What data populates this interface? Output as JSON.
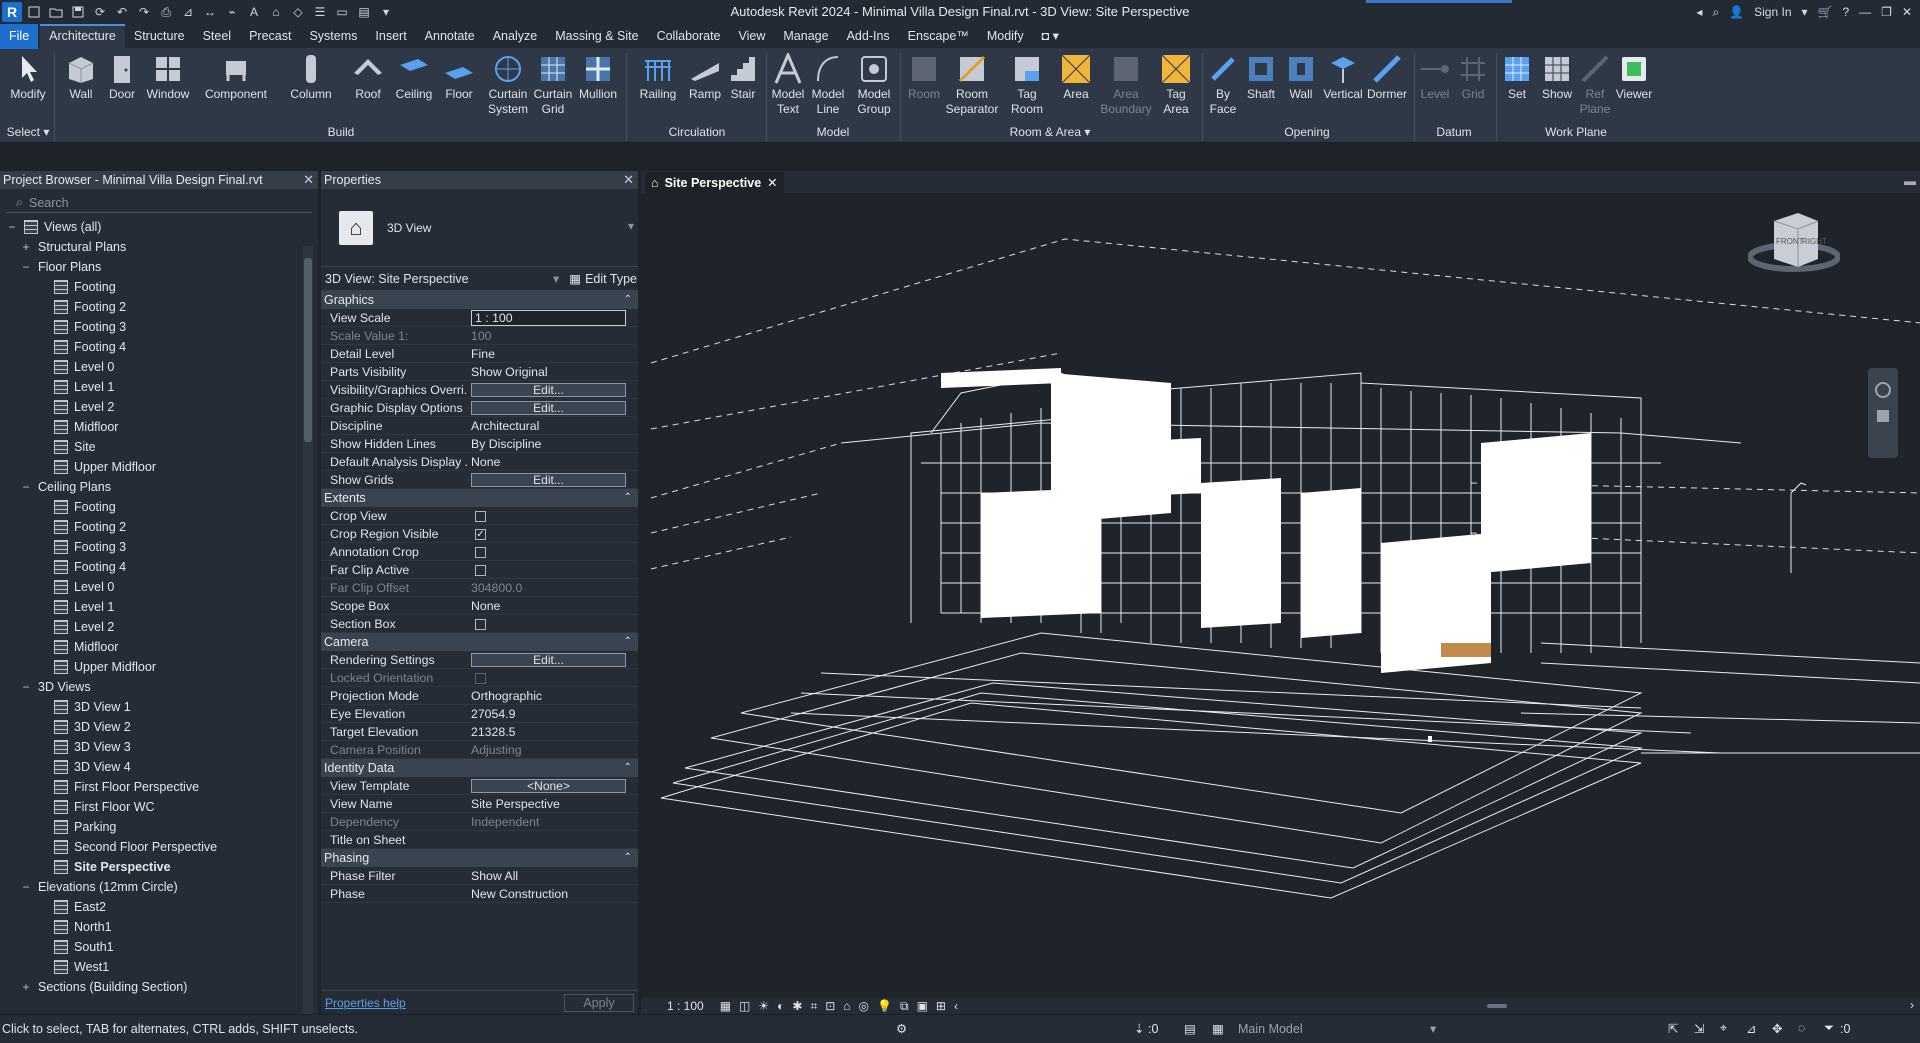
{
  "app": {
    "title": "Autodesk Revit 2024 - Minimal Villa Design Final.rvt - 3D View: Site Perspective",
    "sign_in": "Sign In"
  },
  "menu": [
    "File",
    "Architecture",
    "Structure",
    "Steel",
    "Precast",
    "Systems",
    "Insert",
    "Annotate",
    "Analyze",
    "Massing & Site",
    "Collaborate",
    "View",
    "Manage",
    "Add-Ins",
    "Enscape™",
    "Modify"
  ],
  "ribbon": {
    "select": "Select",
    "buttons": {
      "modify": "Modify",
      "wall": "Wall",
      "door": "Door",
      "window": "Window",
      "component": "Component",
      "column": "Column",
      "roof": "Roof",
      "ceiling": "Ceiling",
      "floor": "Floor",
      "curtain_system": "Curtain\nSystem",
      "curtain_grid": "Curtain\nGrid",
      "mullion": "Mullion",
      "railing": "Railing",
      "ramp": "Ramp",
      "stair": "Stair",
      "model_text": "Model\nText",
      "model_line": "Model\nLine",
      "model_group": "Model\nGroup",
      "room": "Room",
      "room_separator": "Room\nSeparator",
      "tag_room": "Tag\nRoom",
      "area": "Area",
      "area_boundary": "Area\nBoundary",
      "tag_area": "Tag\nArea",
      "by_face": "By\nFace",
      "shaft": "Shaft",
      "wall_op": "Wall",
      "vertical": "Vertical",
      "dormer": "Dormer",
      "level": "Level",
      "grid": "Grid",
      "set": "Set",
      "show": "Show",
      "ref_plane": "Ref\nPlane",
      "viewer": "Viewer"
    },
    "panels": {
      "build": "Build",
      "circulation": "Circulation",
      "model": "Model",
      "room_area": "Room & Area",
      "opening": "Opening",
      "datum": "Datum",
      "work_plane": "Work Plane"
    }
  },
  "project_browser": {
    "title": "Project Browser - Minimal Villa Design Final.rvt",
    "search_placeholder": "Search",
    "tree": [
      {
        "label": "Views (all)",
        "level": 0,
        "toggle": "−",
        "icon": "views"
      },
      {
        "label": "Structural Plans",
        "level": 1,
        "toggle": "+"
      },
      {
        "label": "Floor Plans",
        "level": 1,
        "toggle": "−"
      },
      {
        "label": "Footing",
        "level": 2
      },
      {
        "label": "Footing 2",
        "level": 2
      },
      {
        "label": "Footing 3",
        "level": 2
      },
      {
        "label": "Footing 4",
        "level": 2
      },
      {
        "label": "Level 0",
        "level": 2
      },
      {
        "label": "Level 1",
        "level": 2
      },
      {
        "label": "Level 2",
        "level": 2
      },
      {
        "label": "Midfloor",
        "level": 2
      },
      {
        "label": "Site",
        "level": 2
      },
      {
        "label": "Upper Midfloor",
        "level": 2
      },
      {
        "label": "Ceiling Plans",
        "level": 1,
        "toggle": "−"
      },
      {
        "label": "Footing",
        "level": 2
      },
      {
        "label": "Footing 2",
        "level": 2
      },
      {
        "label": "Footing 3",
        "level": 2
      },
      {
        "label": "Footing 4",
        "level": 2
      },
      {
        "label": "Level 0",
        "level": 2
      },
      {
        "label": "Level 1",
        "level": 2
      },
      {
        "label": "Level 2",
        "level": 2
      },
      {
        "label": "Midfloor",
        "level": 2
      },
      {
        "label": "Upper Midfloor",
        "level": 2
      },
      {
        "label": "3D Views",
        "level": 1,
        "toggle": "−"
      },
      {
        "label": "3D View 1",
        "level": 2
      },
      {
        "label": "3D View 2",
        "level": 2
      },
      {
        "label": "3D View 3",
        "level": 2
      },
      {
        "label": "3D View 4",
        "level": 2
      },
      {
        "label": "First Floor Perspective",
        "level": 2
      },
      {
        "label": "First Floor WC",
        "level": 2
      },
      {
        "label": "Parking",
        "level": 2
      },
      {
        "label": "Second Floor Perspective",
        "level": 2
      },
      {
        "label": "Site Perspective",
        "level": 2,
        "bold": true
      },
      {
        "label": "Elevations (12mm Circle)",
        "level": 1,
        "toggle": "−"
      },
      {
        "label": "East2",
        "level": 2
      },
      {
        "label": "North1",
        "level": 2
      },
      {
        "label": "South1",
        "level": 2
      },
      {
        "label": "West1",
        "level": 2
      },
      {
        "label": "Sections (Building Section)",
        "level": 1,
        "toggle": "+"
      }
    ]
  },
  "properties": {
    "title": "Properties",
    "type_name": "3D View",
    "instance": "3D View: Site Perspective",
    "edit_type": "Edit Type",
    "groups": [
      {
        "name": "Graphics",
        "rows": [
          {
            "k": "View Scale",
            "v": "1 : 100",
            "kind": "box"
          },
          {
            "k": "Scale Value    1:",
            "v": "100",
            "dis": true
          },
          {
            "k": "Detail Level",
            "v": "Fine"
          },
          {
            "k": "Parts Visibility",
            "v": "Show Original"
          },
          {
            "k": "Visibility/Graphics Overri...",
            "v": "Edit...",
            "kind": "btn"
          },
          {
            "k": "Graphic Display Options",
            "v": "Edit...",
            "kind": "btn"
          },
          {
            "k": "Discipline",
            "v": "Architectural"
          },
          {
            "k": "Show Hidden Lines",
            "v": "By Discipline"
          },
          {
            "k": "Default Analysis Display ...",
            "v": "None"
          },
          {
            "k": "Show Grids",
            "v": "Edit...",
            "kind": "btn"
          }
        ]
      },
      {
        "name": "Extents",
        "rows": [
          {
            "k": "Crop View",
            "v": "",
            "kind": "chk"
          },
          {
            "k": "Crop Region Visible",
            "v": "✓",
            "kind": "chk"
          },
          {
            "k": "Annotation Crop",
            "v": "",
            "kind": "chk"
          },
          {
            "k": "Far Clip Active",
            "v": "",
            "kind": "chk"
          },
          {
            "k": "Far Clip Offset",
            "v": "304800.0",
            "dis": true
          },
          {
            "k": "Scope Box",
            "v": "None"
          },
          {
            "k": "Section Box",
            "v": "",
            "kind": "chk"
          }
        ]
      },
      {
        "name": "Camera",
        "rows": [
          {
            "k": "Rendering Settings",
            "v": "Edit...",
            "kind": "btn"
          },
          {
            "k": "Locked Orientation",
            "v": "",
            "kind": "chk",
            "dis": true
          },
          {
            "k": "Projection Mode",
            "v": "Orthographic"
          },
          {
            "k": "Eye Elevation",
            "v": "27054.9"
          },
          {
            "k": "Target Elevation",
            "v": "21328.5"
          },
          {
            "k": "Camera Position",
            "v": "Adjusting",
            "dis": true
          }
        ]
      },
      {
        "name": "Identity Data",
        "rows": [
          {
            "k": "View Template",
            "v": "<None>",
            "kind": "btn"
          },
          {
            "k": "View Name",
            "v": "Site Perspective"
          },
          {
            "k": "Dependency",
            "v": "Independent",
            "dis": true
          },
          {
            "k": "Title on Sheet",
            "v": ""
          }
        ]
      },
      {
        "name": "Phasing",
        "rows": [
          {
            "k": "Phase Filter",
            "v": "Show All"
          },
          {
            "k": "Phase",
            "v": "New Construction"
          }
        ]
      }
    ],
    "help": "Properties help",
    "apply": "Apply"
  },
  "view": {
    "tab": "Site Perspective",
    "scale": "1 : 100",
    "cube_front": "FRONT",
    "cube_right": "RIGHT"
  },
  "status": {
    "hint": "Click to select, TAB for alternates, CTRL adds, SHIFT unselects.",
    "zero": ":0",
    "model": "Main Model",
    "filter": ":0"
  },
  "colors": {
    "accent": "#1d6fce",
    "ribbon": "#2e3846",
    "panel": "#262c35",
    "viewport": "#1f242b"
  }
}
